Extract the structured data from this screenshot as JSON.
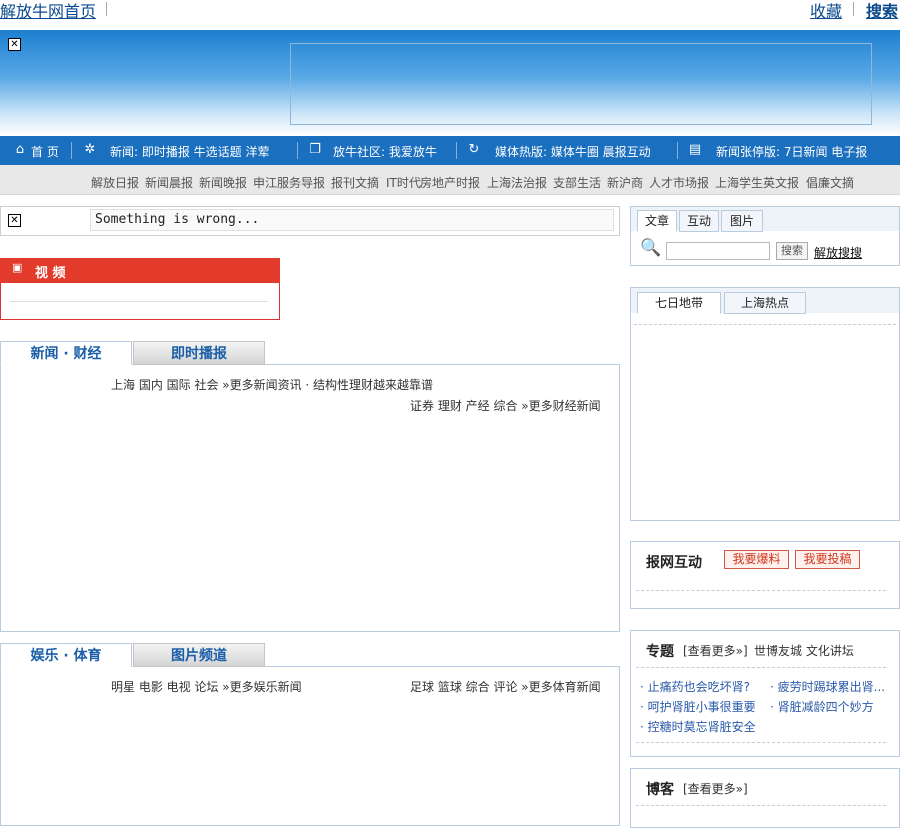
{
  "top": {
    "home_link": "解放牛网首页",
    "favorite": "收藏",
    "search": "搜索"
  },
  "nav": {
    "home": "首 页",
    "news": "新闻: 即时播报 牛选话题 洋荤",
    "community": "放牛社区: 我爱放牛",
    "media": "媒体热版: 媒体牛圈 晨报互动",
    "paper": "新闻张停版: 7日新闻 电子报"
  },
  "subnav": [
    "解放日报",
    "新闻晨报",
    "新闻晚报",
    "申江服务导报",
    "报刊文摘",
    "IT时代",
    "房地产时报",
    "上海法治报",
    "支部生活",
    "新沪商",
    "人才市场报",
    "上海学生英文报",
    "倡廉文摘"
  ],
  "error_text": "Something is wrong...",
  "video": {
    "title": "视 频"
  },
  "section1": {
    "tab_active": "新闻 · 财经",
    "tab_inactive": "即时播报",
    "line1": "上海 国内 国际 社会 »更多新闻资讯 · 结构性理财越来越靠谱",
    "line2": "证券 理财 产经 综合 »更多财经新闻"
  },
  "section2": {
    "tab_active": "娱乐 · 体育",
    "tab_inactive": "图片频道",
    "left": "明星 电影 电视 论坛 »更多娱乐新闻",
    "right": "足球 篮球 综合 评论 »更多体育新闻"
  },
  "search_box": {
    "tabs": [
      "文章",
      "互动",
      "图片"
    ],
    "button": "搜索",
    "link": "解放搜搜"
  },
  "hot": {
    "tabs": [
      "七日地带",
      "上海热点"
    ]
  },
  "interact": {
    "title": "报网互动",
    "btn1": "我要爆料",
    "btn2": "我要投稿"
  },
  "special": {
    "title": "专题",
    "more": "[查看更多»]",
    "extra": "世博友城 文化讲坛",
    "items": [
      "· 止痛药也会吃坏肾?",
      "· 疲劳时踢球累出肾...",
      "· 呵护肾脏小事很重要",
      "· 肾脏减龄四个妙方",
      "· 控糖时莫忘肾脏安全"
    ]
  },
  "blog": {
    "title": "博客",
    "more": "[查看更多»]"
  }
}
